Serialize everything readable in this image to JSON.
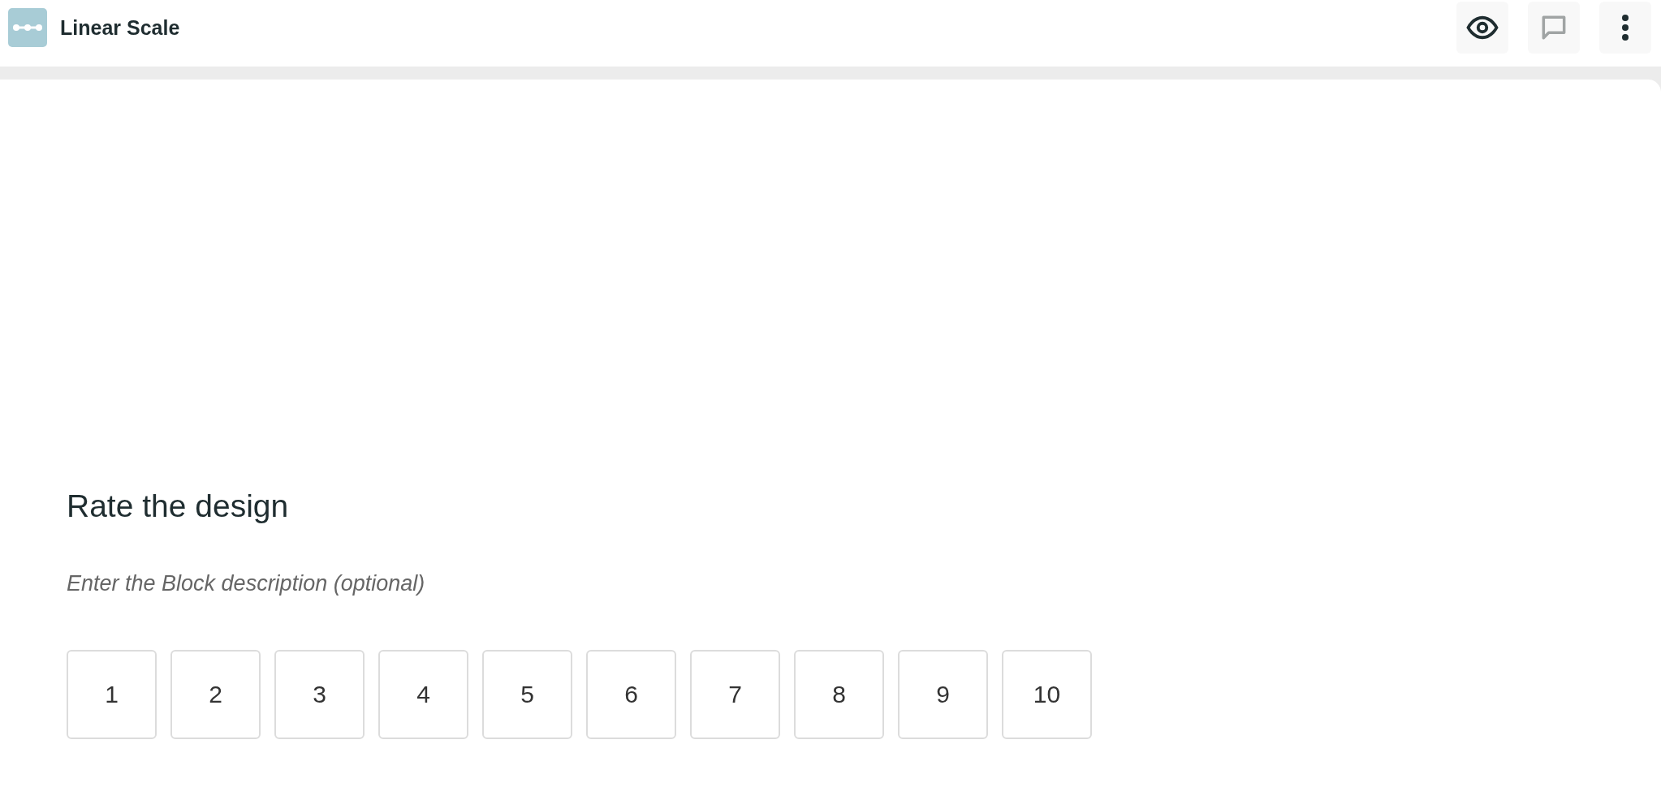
{
  "header": {
    "title": "Linear Scale"
  },
  "block": {
    "question": "Rate the design",
    "description": {
      "placeholder": "Enter the Block description (optional)"
    },
    "options": [
      "1",
      "2",
      "3",
      "4",
      "5",
      "6",
      "7",
      "8",
      "9",
      "10"
    ]
  }
}
